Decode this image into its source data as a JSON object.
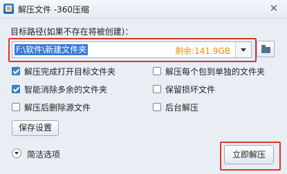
{
  "window": {
    "title": "解压文件 -360压缩",
    "close_symbol": "✕"
  },
  "path": {
    "label": "目标路径(如果不存在将被创建)：",
    "value": "F:\\软件\\新建文件夹",
    "free_space": "剩余:141.9GB"
  },
  "options": [
    {
      "label": "解压完成打开目标文件夹",
      "checked": true
    },
    {
      "label": "解压每个包到单独的文件夹",
      "checked": false
    },
    {
      "label": "智能消除多余的文件夹",
      "checked": true
    },
    {
      "label": "保留损坏文件",
      "checked": false
    },
    {
      "label": "解压后删除源文件",
      "checked": false
    },
    {
      "label": "后台解压",
      "checked": false
    }
  ],
  "buttons": {
    "save_settings": "保存设置",
    "simple_options": "简洁选项",
    "extract_now": "立即解压"
  },
  "colors": {
    "accent": "#3a7bd5",
    "highlight": "#e0312b",
    "free_space": "#f28a00"
  }
}
